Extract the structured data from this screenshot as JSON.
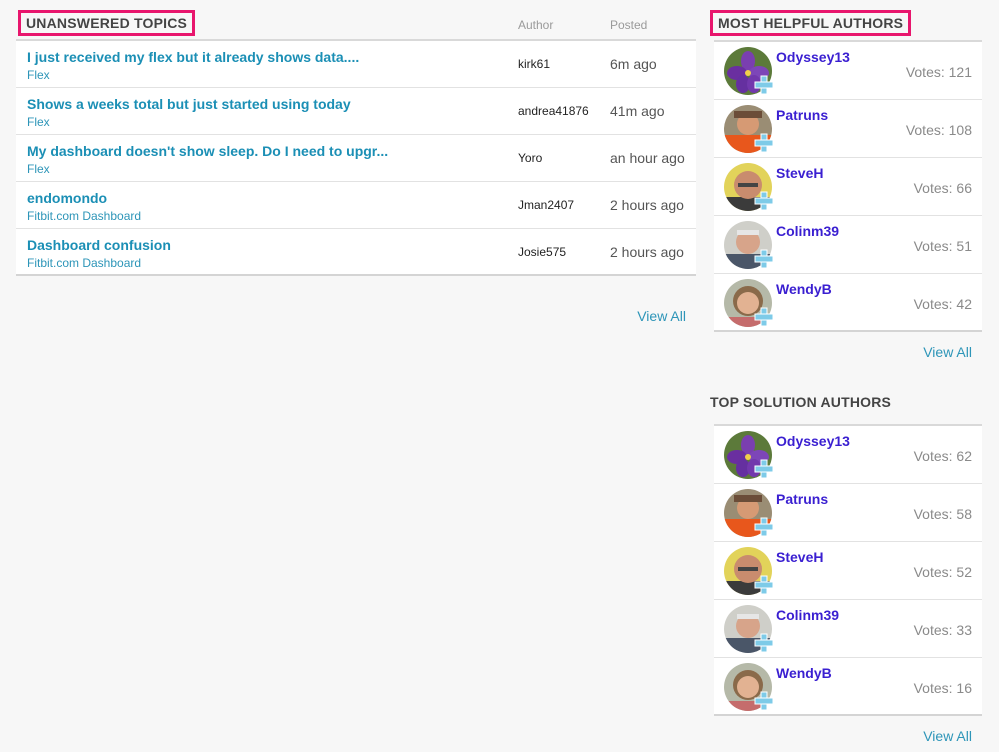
{
  "unanswered": {
    "title": "UNANSWERED TOPICS",
    "col_author": "Author",
    "col_posted": "Posted",
    "view_all": "View All",
    "topics": [
      {
        "title": "I just received my flex but it already shows data....",
        "board": "Flex",
        "author": "kirk61",
        "posted": "6m ago"
      },
      {
        "title": "Shows a weeks total but just started using today",
        "board": "Flex",
        "author": "andrea41876",
        "posted": "41m ago"
      },
      {
        "title": "My dashboard doesn't show sleep. Do I need to upgr...",
        "board": "Flex",
        "author": "Yoro",
        "posted": "an hour ago"
      },
      {
        "title": "endomondo",
        "board": "Fitbit.com Dashboard",
        "author": "Jman2407",
        "posted": "2 hours ago"
      },
      {
        "title": "Dashboard confusion",
        "board": "Fitbit.com Dashboard",
        "author": "Josie575",
        "posted": "2 hours ago"
      }
    ]
  },
  "helpful": {
    "title": "MOST HELPFUL AUTHORS",
    "view_all": "View All",
    "authors": [
      {
        "name": "Odyssey13",
        "votes": "Votes: 121",
        "avatar": "flower"
      },
      {
        "name": "Patruns",
        "votes": "Votes: 108",
        "avatar": "orange-shirt"
      },
      {
        "name": "SteveH",
        "votes": "Votes: 66",
        "avatar": "bald-man"
      },
      {
        "name": "Colinm39",
        "votes": "Votes: 51",
        "avatar": "grey-man"
      },
      {
        "name": "WendyB",
        "votes": "Votes: 42",
        "avatar": "woman"
      }
    ]
  },
  "solution": {
    "title": "TOP SOLUTION AUTHORS",
    "view_all": "View All",
    "authors": [
      {
        "name": "Odyssey13",
        "votes": "Votes: 62",
        "avatar": "flower"
      },
      {
        "name": "Patruns",
        "votes": "Votes: 58",
        "avatar": "orange-shirt"
      },
      {
        "name": "SteveH",
        "votes": "Votes: 52",
        "avatar": "bald-man"
      },
      {
        "name": "Colinm39",
        "votes": "Votes: 33",
        "avatar": "grey-man"
      },
      {
        "name": "WendyB",
        "votes": "Votes: 16",
        "avatar": "woman"
      }
    ]
  },
  "colors": {
    "link": "#1b8fb5",
    "author_name": "#3a1fd1",
    "highlight_box": "#e8166d"
  }
}
